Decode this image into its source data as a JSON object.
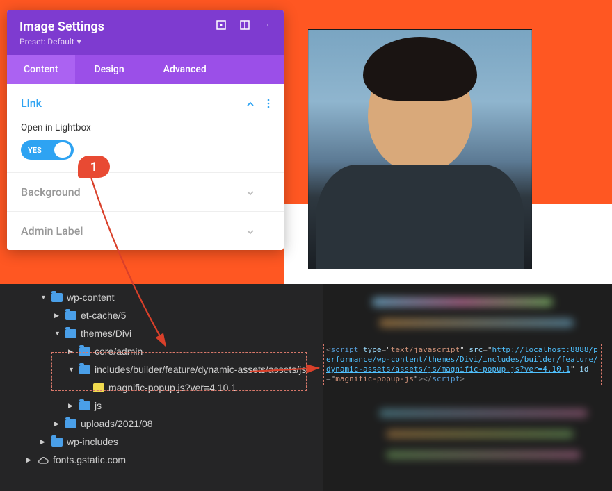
{
  "panel": {
    "title": "Image Settings",
    "preset_label": "Preset: Default"
  },
  "tabs": {
    "content": "Content",
    "design": "Design",
    "advanced": "Advanced"
  },
  "sections": {
    "link": {
      "title": "Link",
      "lightbox_label": "Open in Lightbox",
      "toggle_yes": "YES"
    },
    "background": {
      "title": "Background"
    },
    "admin_label": {
      "title": "Admin Label"
    }
  },
  "annotation": {
    "number": "1"
  },
  "tree": {
    "items": [
      {
        "level": 1,
        "twisty": "▼",
        "type": "folder",
        "label": "wp-content"
      },
      {
        "level": 2,
        "twisty": "▶",
        "type": "folder",
        "label": "et-cache/5"
      },
      {
        "level": 2,
        "twisty": "▼",
        "type": "folder",
        "label": "themes/Divi"
      },
      {
        "level": 3,
        "twisty": "▶",
        "type": "folder",
        "label": "core/admin"
      },
      {
        "level": 3,
        "twisty": "▼",
        "type": "folder",
        "label": "includes/builder/feature/dynamic-assets/assets/js"
      },
      {
        "level": 3,
        "twisty": "",
        "type": "file-js",
        "label": "magnific-popup.js?ver=4.10.1"
      },
      {
        "level": 3,
        "twisty": "▶",
        "type": "folder",
        "label": "js"
      },
      {
        "level": 2,
        "twisty": "▶",
        "type": "folder",
        "label": "uploads/2021/08"
      },
      {
        "level": 1,
        "twisty": "▶",
        "type": "folder",
        "label": "wp-includes"
      },
      {
        "level": 0,
        "twisty": "▶",
        "type": "cloud",
        "label": "fonts.gstatic.com"
      }
    ]
  },
  "code": {
    "tag_open": "script",
    "attr_type": "type",
    "val_type": "text/javascript",
    "attr_src": "src",
    "val_src": "http://localhost:8888/performance/wp-content/themes/Divi/includes/builder/feature/dynamic-assets/assets/js/magnific-popup.js?ver=4.10.1",
    "attr_id": "id",
    "val_id": "magnific-popup-js",
    "tag_close": "script"
  }
}
